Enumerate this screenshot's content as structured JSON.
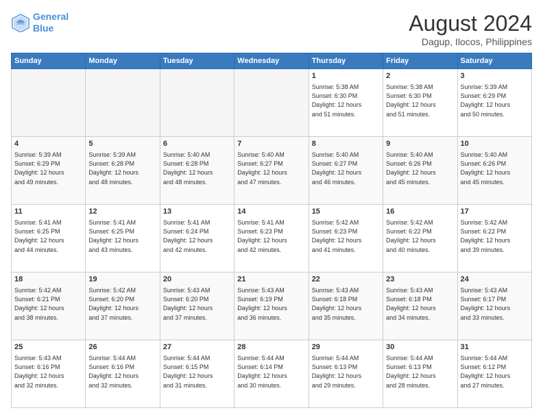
{
  "logo": {
    "line1": "General",
    "line2": "Blue"
  },
  "title": "August 2024",
  "subtitle": "Dagup, Ilocos, Philippines",
  "days_of_week": [
    "Sunday",
    "Monday",
    "Tuesday",
    "Wednesday",
    "Thursday",
    "Friday",
    "Saturday"
  ],
  "weeks": [
    [
      {
        "day": "",
        "info": ""
      },
      {
        "day": "",
        "info": ""
      },
      {
        "day": "",
        "info": ""
      },
      {
        "day": "",
        "info": ""
      },
      {
        "day": "1",
        "info": "Sunrise: 5:38 AM\nSunset: 6:30 PM\nDaylight: 12 hours\nand 51 minutes."
      },
      {
        "day": "2",
        "info": "Sunrise: 5:38 AM\nSunset: 6:30 PM\nDaylight: 12 hours\nand 51 minutes."
      },
      {
        "day": "3",
        "info": "Sunrise: 5:39 AM\nSunset: 6:29 PM\nDaylight: 12 hours\nand 50 minutes."
      }
    ],
    [
      {
        "day": "4",
        "info": "Sunrise: 5:39 AM\nSunset: 6:29 PM\nDaylight: 12 hours\nand 49 minutes."
      },
      {
        "day": "5",
        "info": "Sunrise: 5:39 AM\nSunset: 6:28 PM\nDaylight: 12 hours\nand 48 minutes."
      },
      {
        "day": "6",
        "info": "Sunrise: 5:40 AM\nSunset: 6:28 PM\nDaylight: 12 hours\nand 48 minutes."
      },
      {
        "day": "7",
        "info": "Sunrise: 5:40 AM\nSunset: 6:27 PM\nDaylight: 12 hours\nand 47 minutes."
      },
      {
        "day": "8",
        "info": "Sunrise: 5:40 AM\nSunset: 6:27 PM\nDaylight: 12 hours\nand 46 minutes."
      },
      {
        "day": "9",
        "info": "Sunrise: 5:40 AM\nSunset: 6:26 PM\nDaylight: 12 hours\nand 45 minutes."
      },
      {
        "day": "10",
        "info": "Sunrise: 5:40 AM\nSunset: 6:26 PM\nDaylight: 12 hours\nand 45 minutes."
      }
    ],
    [
      {
        "day": "11",
        "info": "Sunrise: 5:41 AM\nSunset: 6:25 PM\nDaylight: 12 hours\nand 44 minutes."
      },
      {
        "day": "12",
        "info": "Sunrise: 5:41 AM\nSunset: 6:25 PM\nDaylight: 12 hours\nand 43 minutes."
      },
      {
        "day": "13",
        "info": "Sunrise: 5:41 AM\nSunset: 6:24 PM\nDaylight: 12 hours\nand 42 minutes."
      },
      {
        "day": "14",
        "info": "Sunrise: 5:41 AM\nSunset: 6:23 PM\nDaylight: 12 hours\nand 42 minutes."
      },
      {
        "day": "15",
        "info": "Sunrise: 5:42 AM\nSunset: 6:23 PM\nDaylight: 12 hours\nand 41 minutes."
      },
      {
        "day": "16",
        "info": "Sunrise: 5:42 AM\nSunset: 6:22 PM\nDaylight: 12 hours\nand 40 minutes."
      },
      {
        "day": "17",
        "info": "Sunrise: 5:42 AM\nSunset: 6:22 PM\nDaylight: 12 hours\nand 39 minutes."
      }
    ],
    [
      {
        "day": "18",
        "info": "Sunrise: 5:42 AM\nSunset: 6:21 PM\nDaylight: 12 hours\nand 38 minutes."
      },
      {
        "day": "19",
        "info": "Sunrise: 5:42 AM\nSunset: 6:20 PM\nDaylight: 12 hours\nand 37 minutes."
      },
      {
        "day": "20",
        "info": "Sunrise: 5:43 AM\nSunset: 6:20 PM\nDaylight: 12 hours\nand 37 minutes."
      },
      {
        "day": "21",
        "info": "Sunrise: 5:43 AM\nSunset: 6:19 PM\nDaylight: 12 hours\nand 36 minutes."
      },
      {
        "day": "22",
        "info": "Sunrise: 5:43 AM\nSunset: 6:18 PM\nDaylight: 12 hours\nand 35 minutes."
      },
      {
        "day": "23",
        "info": "Sunrise: 5:43 AM\nSunset: 6:18 PM\nDaylight: 12 hours\nand 34 minutes."
      },
      {
        "day": "24",
        "info": "Sunrise: 5:43 AM\nSunset: 6:17 PM\nDaylight: 12 hours\nand 33 minutes."
      }
    ],
    [
      {
        "day": "25",
        "info": "Sunrise: 5:43 AM\nSunset: 6:16 PM\nDaylight: 12 hours\nand 32 minutes."
      },
      {
        "day": "26",
        "info": "Sunrise: 5:44 AM\nSunset: 6:16 PM\nDaylight: 12 hours\nand 32 minutes."
      },
      {
        "day": "27",
        "info": "Sunrise: 5:44 AM\nSunset: 6:15 PM\nDaylight: 12 hours\nand 31 minutes."
      },
      {
        "day": "28",
        "info": "Sunrise: 5:44 AM\nSunset: 6:14 PM\nDaylight: 12 hours\nand 30 minutes."
      },
      {
        "day": "29",
        "info": "Sunrise: 5:44 AM\nSunset: 6:13 PM\nDaylight: 12 hours\nand 29 minutes."
      },
      {
        "day": "30",
        "info": "Sunrise: 5:44 AM\nSunset: 6:13 PM\nDaylight: 12 hours\nand 28 minutes."
      },
      {
        "day": "31",
        "info": "Sunrise: 5:44 AM\nSunset: 6:12 PM\nDaylight: 12 hours\nand 27 minutes."
      }
    ]
  ]
}
